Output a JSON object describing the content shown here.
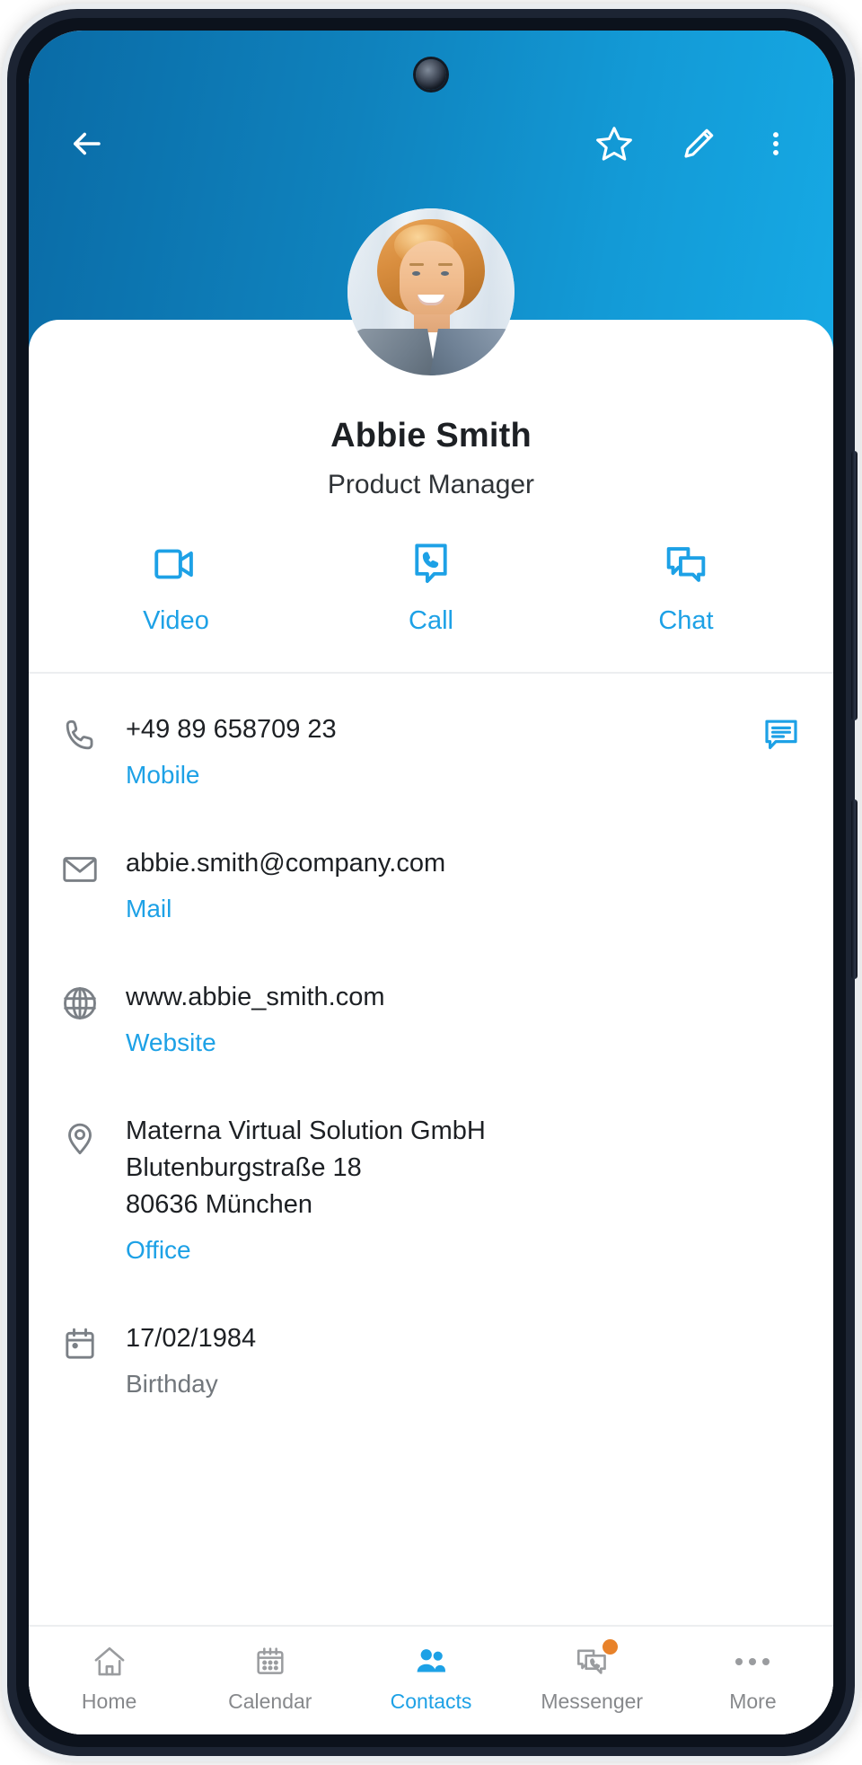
{
  "theme": {
    "header_gradient_start": "#0a6ba6",
    "header_gradient_end": "#16a9e4",
    "accent_blue": "#1da1e6",
    "text_primary": "#1d2024",
    "text_muted": "#72777c",
    "badge_orange": "#e8822a",
    "frame_color": "#1c2433"
  },
  "appbar": {
    "back_label": "Back",
    "favorite_label": "Favorite",
    "edit_label": "Edit",
    "overflow_label": "More options",
    "icons": {
      "back": "arrow-left-icon",
      "favorite": "star-outline-icon",
      "edit": "pencil-icon",
      "overflow": "dots-vertical-icon"
    }
  },
  "profile": {
    "name": "Abbie Smith",
    "role": "Product Manager",
    "avatar_alt": "Abbie Smith profile photo"
  },
  "quick_actions": [
    {
      "label": "Video",
      "icon": "video-camera-icon"
    },
    {
      "label": "Call",
      "icon": "phone-bubble-icon"
    },
    {
      "label": "Chat",
      "icon": "chat-bubbles-icon"
    }
  ],
  "details": [
    {
      "icon": "phone-icon",
      "value": "+49 89 658709 23",
      "label": "Mobile",
      "label_muted": false,
      "trailing_icon": "message-bubble-icon"
    },
    {
      "icon": "envelope-icon",
      "value": "abbie.smith@company.com",
      "label": "Mail",
      "label_muted": false,
      "trailing_icon": null
    },
    {
      "icon": "globe-icon",
      "value": "www.abbie_smith.com",
      "label": "Website",
      "label_muted": false,
      "trailing_icon": null
    },
    {
      "icon": "location-pin-icon",
      "value": "Materna Virtual Solution GmbH\nBlutenburgstraße 18\n80636 München",
      "label": "Office",
      "label_muted": false,
      "trailing_icon": null
    },
    {
      "icon": "calendar-icon",
      "value": "17/02/1984",
      "label": "Birthday",
      "label_muted": true,
      "trailing_icon": null
    }
  ],
  "bottom_nav": {
    "active_index": 2,
    "items": [
      {
        "label": "Home",
        "icon": "home-icon",
        "badge": false
      },
      {
        "label": "Calendar",
        "icon": "calendar-icon",
        "badge": false
      },
      {
        "label": "Contacts",
        "icon": "people-icon",
        "badge": false
      },
      {
        "label": "Messenger",
        "icon": "messenger-icon",
        "badge": true
      },
      {
        "label": "More",
        "icon": "dots-horizontal-icon",
        "badge": false
      }
    ]
  }
}
